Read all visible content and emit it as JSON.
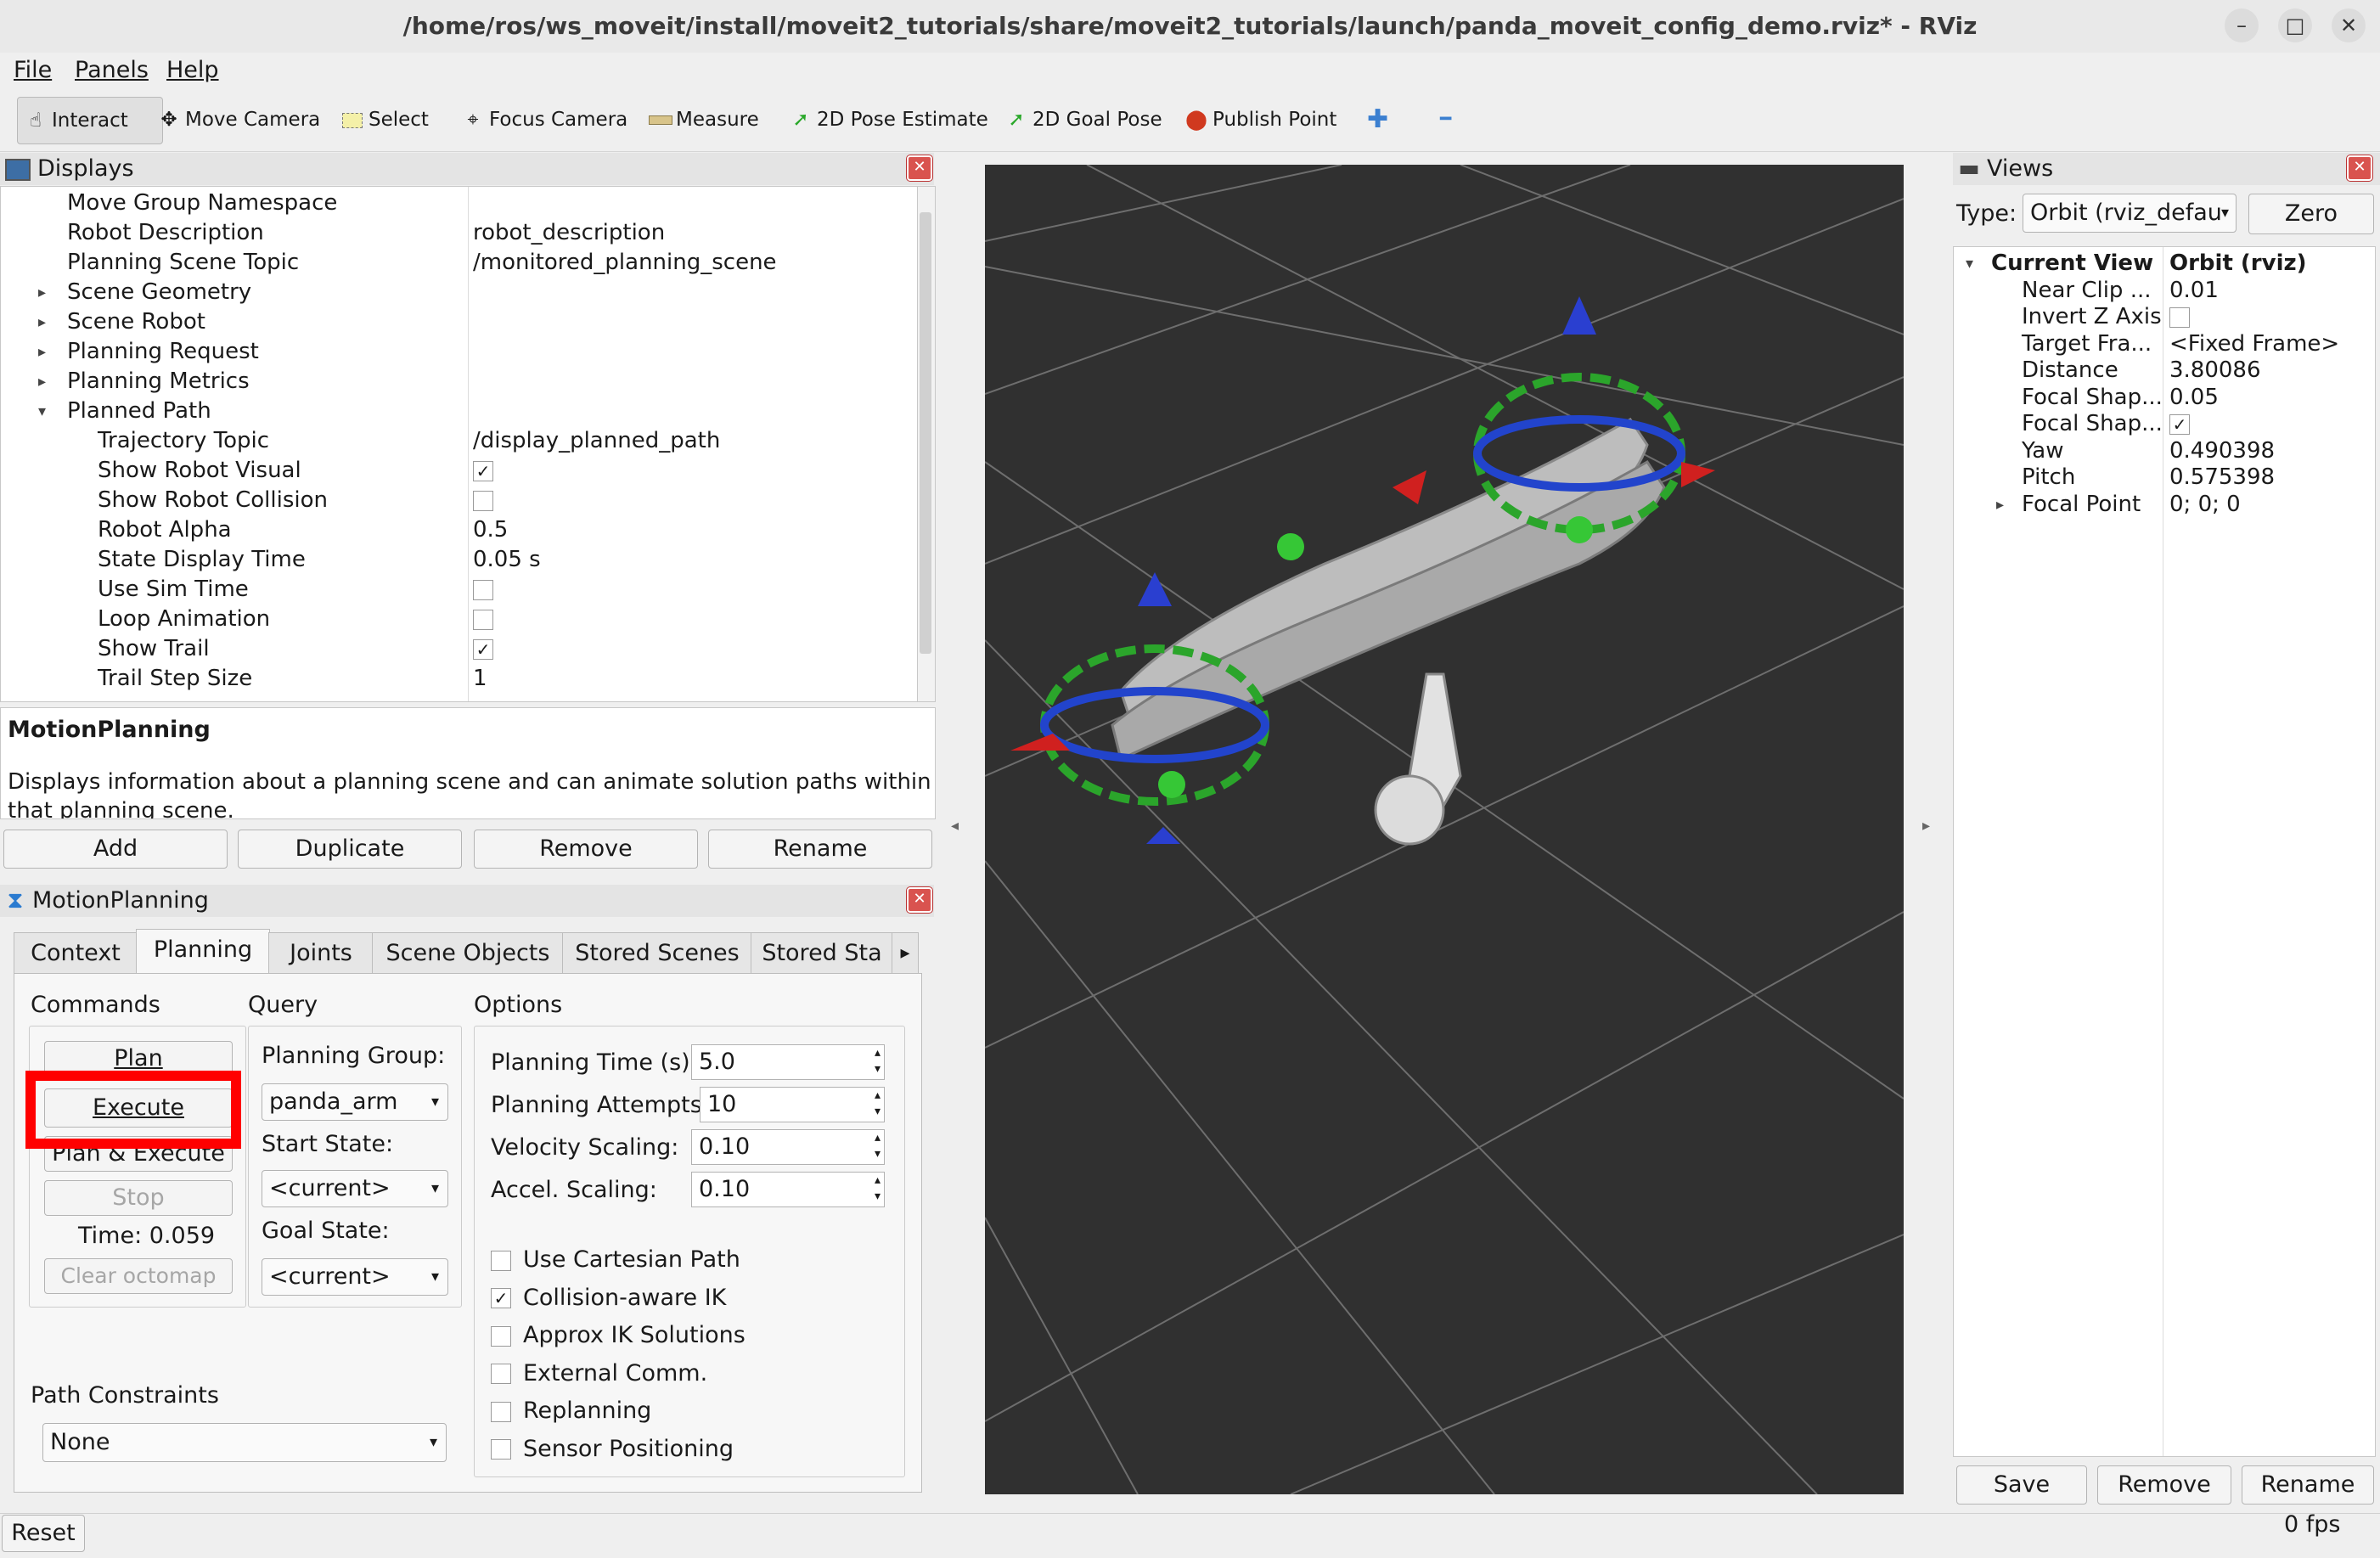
{
  "window": {
    "title": "/home/ros/ws_moveit/install/moveit2_tutorials/share/moveit2_tutorials/launch/panda_moveit_config_demo.rviz* - RViz",
    "minimize_glyph": "–",
    "maximize_glyph": "□",
    "close_glyph": "✕"
  },
  "menu": {
    "file": "File",
    "panels": "Panels",
    "help": "Help"
  },
  "toolbar": {
    "interact": "Interact",
    "move_camera": "Move Camera",
    "select": "Select",
    "focus_camera": "Focus Camera",
    "measure": "Measure",
    "pose_estimate": "2D Pose Estimate",
    "goal_pose": "2D Goal Pose",
    "publish_point": "Publish Point",
    "add_glyph": "✚",
    "remove_glyph": "━"
  },
  "displays": {
    "title": "Displays",
    "rows": [
      {
        "name": "Move Group Namespace",
        "value": "",
        "indent": 0,
        "expander": "",
        "check": ""
      },
      {
        "name": "Robot Description",
        "value": "robot_description",
        "indent": 0,
        "expander": "",
        "check": ""
      },
      {
        "name": "Planning Scene Topic",
        "value": "/monitored_planning_scene",
        "indent": 0,
        "expander": "",
        "check": ""
      },
      {
        "name": "Scene Geometry",
        "value": "",
        "indent": 0,
        "expander": "▸",
        "check": ""
      },
      {
        "name": "Scene Robot",
        "value": "",
        "indent": 0,
        "expander": "▸",
        "check": ""
      },
      {
        "name": "Planning Request",
        "value": "",
        "indent": 0,
        "expander": "▸",
        "check": ""
      },
      {
        "name": "Planning Metrics",
        "value": "",
        "indent": 0,
        "expander": "▸",
        "check": ""
      },
      {
        "name": "Planned Path",
        "value": "",
        "indent": 0,
        "expander": "▾",
        "check": ""
      },
      {
        "name": "Trajectory Topic",
        "value": "/display_planned_path",
        "indent": 1,
        "expander": "",
        "check": ""
      },
      {
        "name": "Show Robot Visual",
        "value": "",
        "indent": 1,
        "expander": "",
        "check": "on"
      },
      {
        "name": "Show Robot Collision",
        "value": "",
        "indent": 1,
        "expander": "",
        "check": "off"
      },
      {
        "name": "Robot Alpha",
        "value": "0.5",
        "indent": 1,
        "expander": "",
        "check": ""
      },
      {
        "name": "State Display Time",
        "value": "0.05 s",
        "indent": 1,
        "expander": "",
        "check": ""
      },
      {
        "name": "Use Sim Time",
        "value": "",
        "indent": 1,
        "expander": "",
        "check": "off"
      },
      {
        "name": "Loop Animation",
        "value": "",
        "indent": 1,
        "expander": "",
        "check": "off"
      },
      {
        "name": "Show Trail",
        "value": "",
        "indent": 1,
        "expander": "",
        "check": "on"
      },
      {
        "name": "Trail Step Size",
        "value": "1",
        "indent": 1,
        "expander": "",
        "check": ""
      }
    ],
    "desc_title": "MotionPlanning",
    "desc_text_1": "Displays information about a planning scene and can animate solution paths within",
    "desc_text_2": "that planning scene.",
    "add": "Add",
    "duplicate": "Duplicate",
    "remove": "Remove",
    "rename": "Rename"
  },
  "motion_planning": {
    "title": "MotionPlanning",
    "tabs": [
      "Context",
      "Planning",
      "Joints",
      "Scene Objects",
      "Stored Scenes",
      "Stored Sta"
    ],
    "commands_label": "Commands",
    "plan": "Plan",
    "execute": "Execute",
    "plan_execute": "Plan & Execute",
    "stop": "Stop",
    "time": "Time: 0.059",
    "clear_octomap": "Clear octomap",
    "query_label": "Query",
    "planning_group_label": "Planning Group:",
    "planning_group_value": "panda_arm",
    "start_state_label": "Start State:",
    "start_state_value": "<current>",
    "goal_state_label": "Goal State:",
    "goal_state_value": "<current>",
    "options_label": "Options",
    "planning_time_label": "Planning Time (s):",
    "planning_time_value": "5.0",
    "planning_attempts_label": "Planning Attempts:",
    "planning_attempts_value": "10",
    "velocity_label": "Velocity Scaling:",
    "velocity_value": "0.10",
    "accel_label": "Accel. Scaling:",
    "accel_value": "0.10",
    "checkboxes": [
      {
        "label": "Use Cartesian Path",
        "checked": false
      },
      {
        "label": "Collision-aware IK",
        "checked": true
      },
      {
        "label": "Approx IK Solutions",
        "checked": false
      },
      {
        "label": "External Comm.",
        "checked": false
      },
      {
        "label": "Replanning",
        "checked": false
      },
      {
        "label": "Sensor Positioning",
        "checked": false
      }
    ],
    "path_constraints_label": "Path Constraints",
    "path_constraints_value": "None"
  },
  "views": {
    "title": "Views",
    "type_label": "Type:",
    "type_value": "Orbit (rviz_defau",
    "zero": "Zero",
    "rows": [
      {
        "name": "Current View",
        "value": "Orbit (rviz)",
        "bold": true,
        "expander": "▾",
        "indent": 0,
        "check": ""
      },
      {
        "name": "Near Clip ...",
        "value": "0.01",
        "bold": false,
        "expander": "",
        "indent": 1,
        "check": ""
      },
      {
        "name": "Invert Z Axis",
        "value": "",
        "bold": false,
        "expander": "",
        "indent": 1,
        "check": "off"
      },
      {
        "name": "Target Fra...",
        "value": "<Fixed Frame>",
        "bold": false,
        "expander": "",
        "indent": 1,
        "check": ""
      },
      {
        "name": "Distance",
        "value": "3.80086",
        "bold": false,
        "expander": "",
        "indent": 1,
        "check": ""
      },
      {
        "name": "Focal Shap...",
        "value": "0.05",
        "bold": false,
        "expander": "",
        "indent": 1,
        "check": ""
      },
      {
        "name": "Focal Shap...",
        "value": "",
        "bold": false,
        "expander": "",
        "indent": 1,
        "check": "on"
      },
      {
        "name": "Yaw",
        "value": "0.490398",
        "bold": false,
        "expander": "",
        "indent": 1,
        "check": ""
      },
      {
        "name": "Pitch",
        "value": "0.575398",
        "bold": false,
        "expander": "",
        "indent": 1,
        "check": ""
      },
      {
        "name": "Focal Point",
        "value": "0; 0; 0",
        "bold": false,
        "expander": "▸",
        "indent": 1,
        "check": ""
      }
    ],
    "save": "Save",
    "remove": "Remove",
    "rename": "Rename"
  },
  "status": {
    "reset": "Reset",
    "fps": "0 fps"
  },
  "colors": {
    "highlight": "#ff0000",
    "viewport_bg": "#303030",
    "grid": "#6a6a6a"
  }
}
